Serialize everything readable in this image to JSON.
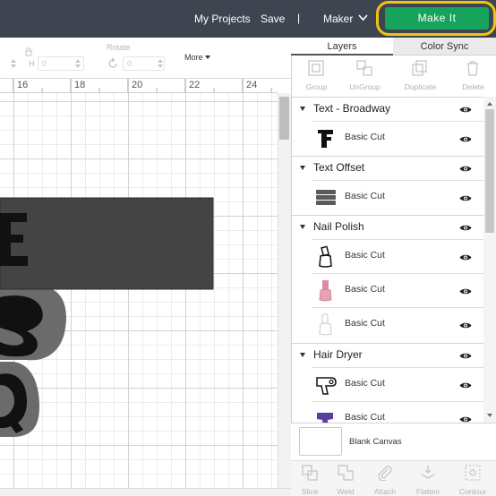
{
  "header": {
    "my_projects": "My Projects",
    "save": "Save",
    "separator": "|",
    "machine": "Maker",
    "make_it": "Make It",
    "colors": {
      "bar": "#3f4451",
      "make_it": "#16a45c",
      "highlight_ring": "#f0c414"
    }
  },
  "toolbar": {
    "h_label": "H",
    "h_value": "0",
    "w_value": "0",
    "rotate_label": "Rotate",
    "rotate_value": "0",
    "more_label": "More"
  },
  "ruler": {
    "numbers": [
      "16",
      "18",
      "20",
      "22",
      "24"
    ]
  },
  "tabs": {
    "layers": "Layers",
    "color_sync": "Color Sync"
  },
  "layer_tools": {
    "group": "Group",
    "ungroup": "UnGroup",
    "duplicate": "Duplicate",
    "delete": "Delete"
  },
  "layers": [
    {
      "title": "Text - Broadway",
      "items": [
        {
          "label": "Basic Cut",
          "icon": "letter-f-thumbnail"
        }
      ]
    },
    {
      "title": "Text Offset",
      "items": [
        {
          "label": "Basic Cut",
          "icon": "text-offset-thumbnail"
        }
      ]
    },
    {
      "title": "Nail Polish",
      "items": [
        {
          "label": "Basic Cut",
          "icon": "nail-polish-outline-thumbnail"
        },
        {
          "label": "Basic Cut",
          "icon": "nail-polish-pink-thumbnail"
        },
        {
          "label": "Basic Cut",
          "icon": "nail-polish-white-thumbnail"
        }
      ]
    },
    {
      "title": "Hair Dryer",
      "items": [
        {
          "label": "Basic Cut",
          "icon": "hair-dryer-outline-thumbnail"
        },
        {
          "label": "Basic Cut",
          "icon": "hair-dryer-purple-thumbnail"
        }
      ]
    }
  ],
  "blank_canvas": {
    "label": "Blank Canvas"
  },
  "bottom_tools": {
    "slice": "Slice",
    "weld": "Weld",
    "attach": "Attach",
    "flatten": "Flatten",
    "contour": "Contour"
  }
}
